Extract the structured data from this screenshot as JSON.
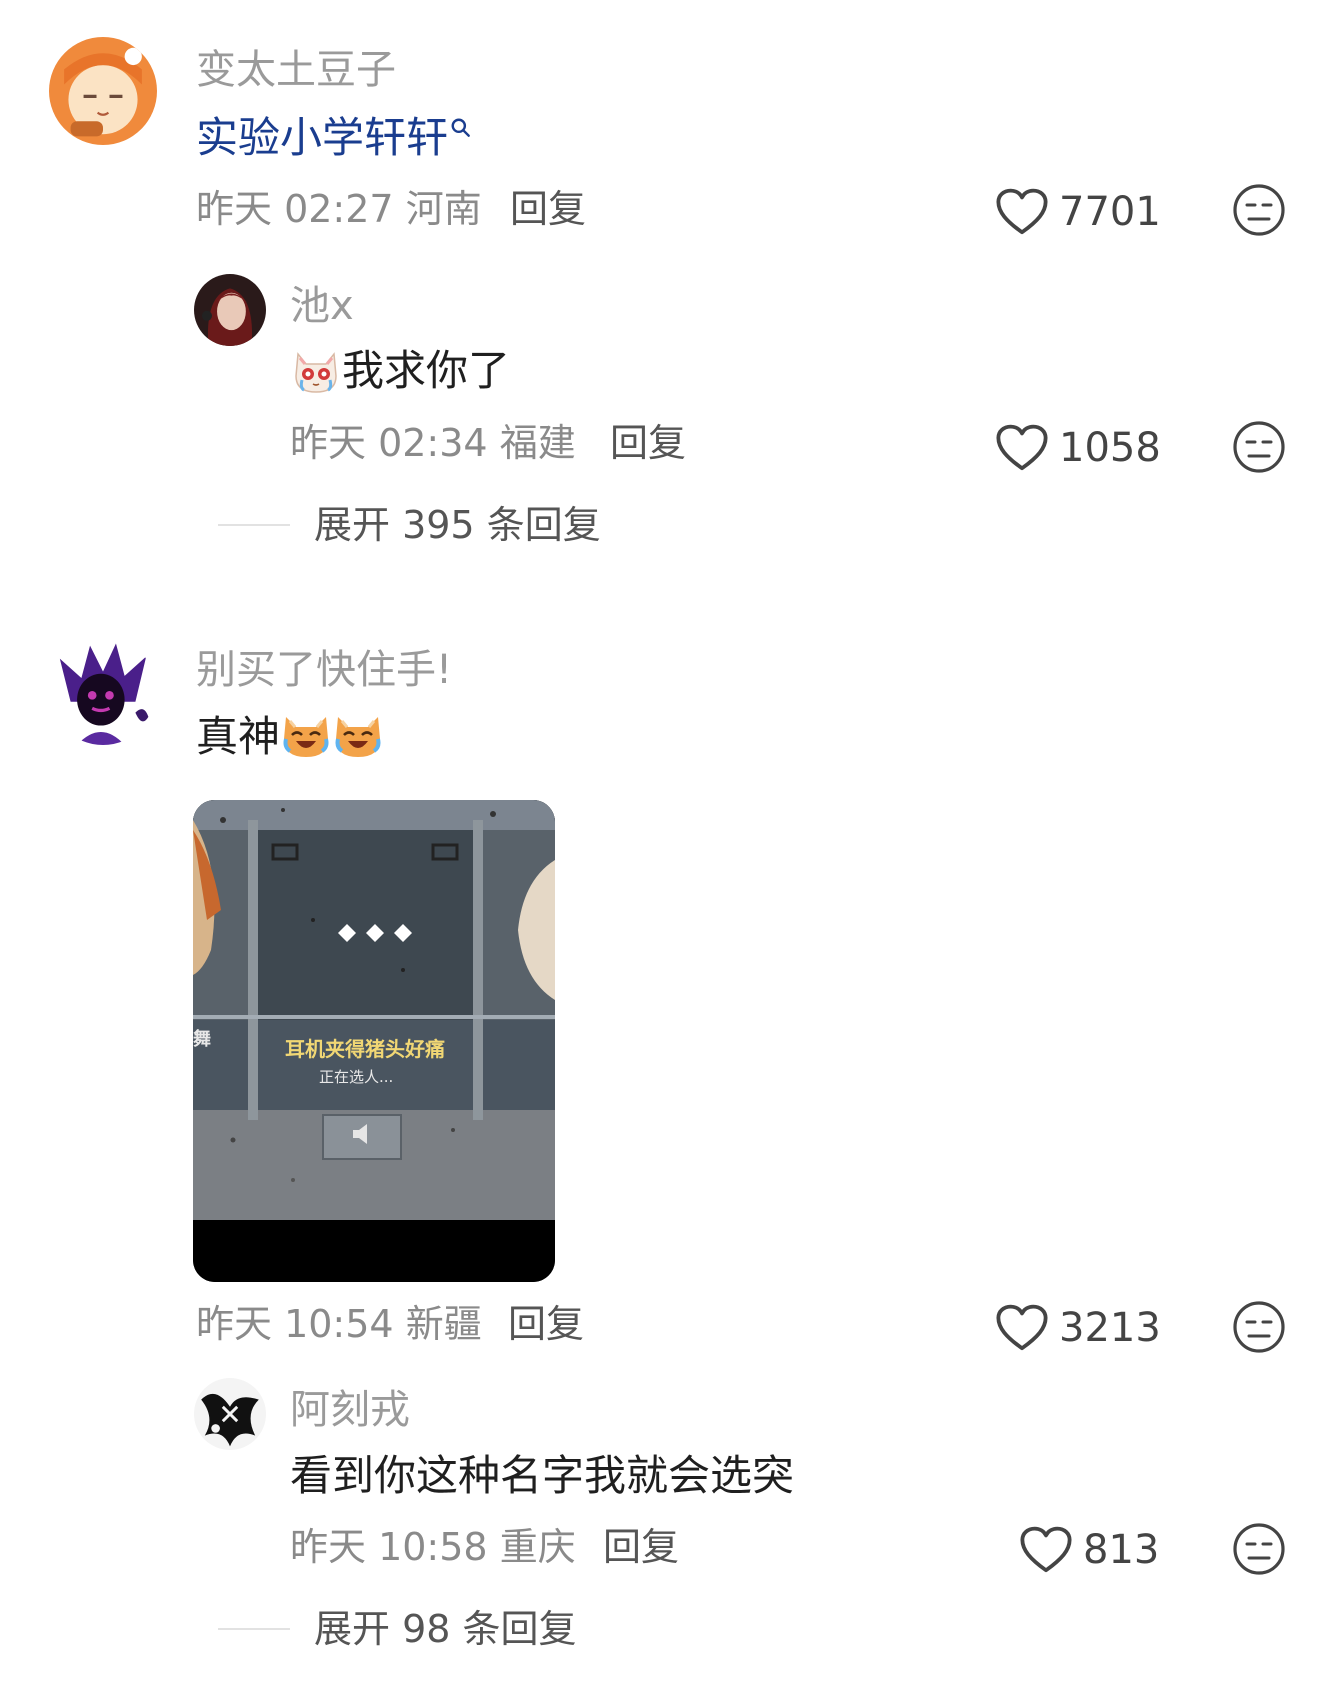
{
  "comments": [
    {
      "username": "变太土豆子",
      "text": "实验小学轩轩",
      "time": "昨天 02:27",
      "location": "河南",
      "reply_label": "回复",
      "likes": "7701",
      "replies": [
        {
          "username": "池x",
          "text": "我求你了",
          "time": "昨天 02:34",
          "location": "福建",
          "reply_label": "回复",
          "likes": "1058"
        }
      ],
      "expand_label": "展开 395 条回复"
    },
    {
      "username": "别买了快住手!",
      "text": "真神",
      "image": {
        "caption": "耳机夹得猪头好痛",
        "subcaption": "正在选人..."
      },
      "time": "昨天 10:54",
      "location": "新疆",
      "reply_label": "回复",
      "likes": "3213",
      "replies": [
        {
          "username": "阿刻戎",
          "text": "看到你这种名字我就会选突",
          "time": "昨天 10:58",
          "location": "重庆",
          "reply_label": "回复",
          "likes": "813"
        }
      ],
      "expand_label": "展开 98 条回复"
    }
  ],
  "icons": {
    "like": "heart-outline-icon",
    "emoji": "neutral-face-icon",
    "search": "search-icon"
  },
  "colors": {
    "username": "#9a9a9a",
    "mention": "#1a3d8f",
    "meta": "#8a8a8a"
  }
}
